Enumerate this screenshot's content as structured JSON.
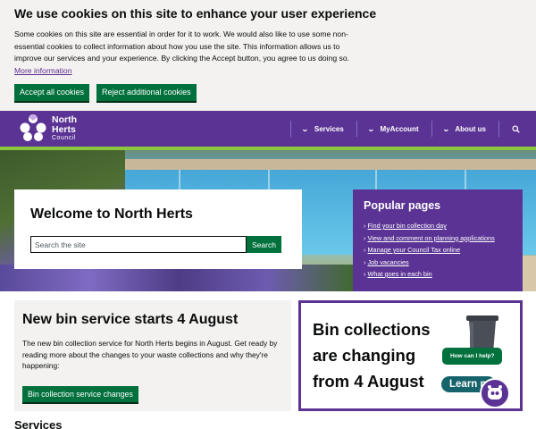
{
  "cookie": {
    "title": "We use cookies on this site to enhance your user experience",
    "body": "Some cookies on this site are essential in order for it to work. We would also like to use some non-essential cookies to collect information about how you use the site. This information allows us to improve our services and your experience. By clicking the Accept button, you agree to us doing so.",
    "more_link": "More information",
    "accept_label": "Accept all cookies",
    "reject_label": "Reject additional cookies"
  },
  "header": {
    "logo_line1": "North",
    "logo_line2": "Herts",
    "logo_line3": "Council",
    "nav": [
      "Services",
      "MyAccount",
      "About us"
    ],
    "search_icon": "search-icon",
    "brand_color": "#5b3394",
    "accent_color": "#8cc63f"
  },
  "hero": {
    "welcome_title": "Welcome to North Herts",
    "search_placeholder": "Search the site",
    "search_button": "Search"
  },
  "popular": {
    "title": "Popular pages",
    "links": [
      "Find your bin collection day",
      "View and comment on planning applications",
      "Manage your Council Tax online",
      "Job vacancies",
      "What goes in each bin"
    ]
  },
  "bin": {
    "title": "New bin service starts 4 August",
    "body": "The new bin collection service for North Herts begins in August. Get ready by reading more about the changes to your waste collections and why they're happening:",
    "button": "Bin collection service changes"
  },
  "promo": {
    "line1": "Bin collections",
    "line2": "are changing",
    "line3": "from 4 August",
    "chat_bubble": "How can I help?",
    "learn": "Learn m"
  },
  "services_heading": "Services"
}
